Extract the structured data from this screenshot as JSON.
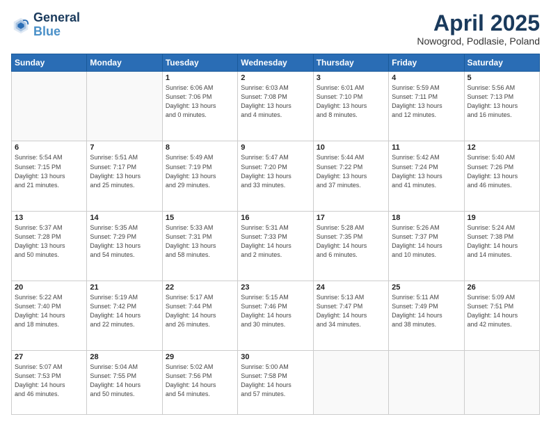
{
  "header": {
    "logo_line1": "General",
    "logo_line2": "Blue",
    "month": "April 2025",
    "location": "Nowogrod, Podlasie, Poland"
  },
  "weekdays": [
    "Sunday",
    "Monday",
    "Tuesday",
    "Wednesday",
    "Thursday",
    "Friday",
    "Saturday"
  ],
  "weeks": [
    [
      {
        "day": null,
        "info": null
      },
      {
        "day": null,
        "info": null
      },
      {
        "day": "1",
        "info": "Sunrise: 6:06 AM\nSunset: 7:06 PM\nDaylight: 13 hours\nand 0 minutes."
      },
      {
        "day": "2",
        "info": "Sunrise: 6:03 AM\nSunset: 7:08 PM\nDaylight: 13 hours\nand 4 minutes."
      },
      {
        "day": "3",
        "info": "Sunrise: 6:01 AM\nSunset: 7:10 PM\nDaylight: 13 hours\nand 8 minutes."
      },
      {
        "day": "4",
        "info": "Sunrise: 5:59 AM\nSunset: 7:11 PM\nDaylight: 13 hours\nand 12 minutes."
      },
      {
        "day": "5",
        "info": "Sunrise: 5:56 AM\nSunset: 7:13 PM\nDaylight: 13 hours\nand 16 minutes."
      }
    ],
    [
      {
        "day": "6",
        "info": "Sunrise: 5:54 AM\nSunset: 7:15 PM\nDaylight: 13 hours\nand 21 minutes."
      },
      {
        "day": "7",
        "info": "Sunrise: 5:51 AM\nSunset: 7:17 PM\nDaylight: 13 hours\nand 25 minutes."
      },
      {
        "day": "8",
        "info": "Sunrise: 5:49 AM\nSunset: 7:19 PM\nDaylight: 13 hours\nand 29 minutes."
      },
      {
        "day": "9",
        "info": "Sunrise: 5:47 AM\nSunset: 7:20 PM\nDaylight: 13 hours\nand 33 minutes."
      },
      {
        "day": "10",
        "info": "Sunrise: 5:44 AM\nSunset: 7:22 PM\nDaylight: 13 hours\nand 37 minutes."
      },
      {
        "day": "11",
        "info": "Sunrise: 5:42 AM\nSunset: 7:24 PM\nDaylight: 13 hours\nand 41 minutes."
      },
      {
        "day": "12",
        "info": "Sunrise: 5:40 AM\nSunset: 7:26 PM\nDaylight: 13 hours\nand 46 minutes."
      }
    ],
    [
      {
        "day": "13",
        "info": "Sunrise: 5:37 AM\nSunset: 7:28 PM\nDaylight: 13 hours\nand 50 minutes."
      },
      {
        "day": "14",
        "info": "Sunrise: 5:35 AM\nSunset: 7:29 PM\nDaylight: 13 hours\nand 54 minutes."
      },
      {
        "day": "15",
        "info": "Sunrise: 5:33 AM\nSunset: 7:31 PM\nDaylight: 13 hours\nand 58 minutes."
      },
      {
        "day": "16",
        "info": "Sunrise: 5:31 AM\nSunset: 7:33 PM\nDaylight: 14 hours\nand 2 minutes."
      },
      {
        "day": "17",
        "info": "Sunrise: 5:28 AM\nSunset: 7:35 PM\nDaylight: 14 hours\nand 6 minutes."
      },
      {
        "day": "18",
        "info": "Sunrise: 5:26 AM\nSunset: 7:37 PM\nDaylight: 14 hours\nand 10 minutes."
      },
      {
        "day": "19",
        "info": "Sunrise: 5:24 AM\nSunset: 7:38 PM\nDaylight: 14 hours\nand 14 minutes."
      }
    ],
    [
      {
        "day": "20",
        "info": "Sunrise: 5:22 AM\nSunset: 7:40 PM\nDaylight: 14 hours\nand 18 minutes."
      },
      {
        "day": "21",
        "info": "Sunrise: 5:19 AM\nSunset: 7:42 PM\nDaylight: 14 hours\nand 22 minutes."
      },
      {
        "day": "22",
        "info": "Sunrise: 5:17 AM\nSunset: 7:44 PM\nDaylight: 14 hours\nand 26 minutes."
      },
      {
        "day": "23",
        "info": "Sunrise: 5:15 AM\nSunset: 7:46 PM\nDaylight: 14 hours\nand 30 minutes."
      },
      {
        "day": "24",
        "info": "Sunrise: 5:13 AM\nSunset: 7:47 PM\nDaylight: 14 hours\nand 34 minutes."
      },
      {
        "day": "25",
        "info": "Sunrise: 5:11 AM\nSunset: 7:49 PM\nDaylight: 14 hours\nand 38 minutes."
      },
      {
        "day": "26",
        "info": "Sunrise: 5:09 AM\nSunset: 7:51 PM\nDaylight: 14 hours\nand 42 minutes."
      }
    ],
    [
      {
        "day": "27",
        "info": "Sunrise: 5:07 AM\nSunset: 7:53 PM\nDaylight: 14 hours\nand 46 minutes."
      },
      {
        "day": "28",
        "info": "Sunrise: 5:04 AM\nSunset: 7:55 PM\nDaylight: 14 hours\nand 50 minutes."
      },
      {
        "day": "29",
        "info": "Sunrise: 5:02 AM\nSunset: 7:56 PM\nDaylight: 14 hours\nand 54 minutes."
      },
      {
        "day": "30",
        "info": "Sunrise: 5:00 AM\nSunset: 7:58 PM\nDaylight: 14 hours\nand 57 minutes."
      },
      {
        "day": null,
        "info": null
      },
      {
        "day": null,
        "info": null
      },
      {
        "day": null,
        "info": null
      }
    ]
  ]
}
